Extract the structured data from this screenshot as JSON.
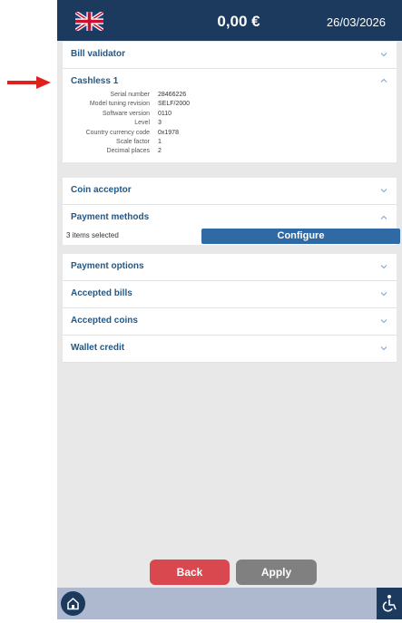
{
  "header": {
    "amount": "0,00 €",
    "date": "26/03/2026"
  },
  "sections": {
    "bill_validator": "Bill validator",
    "cashless": "Cashless 1",
    "coin_acceptor": "Coin acceptor",
    "payment_methods": "Payment methods",
    "payment_options": "Payment options",
    "accepted_bills": "Accepted bills",
    "accepted_coins": "Accepted coins",
    "wallet_credit": "Wallet credit"
  },
  "cashless_details": [
    {
      "label": "Serial number",
      "value": "28466226"
    },
    {
      "label": "Model tuning revision",
      "value": "SELF/2000"
    },
    {
      "label": "Software version",
      "value": "0110"
    },
    {
      "label": "Level",
      "value": "3"
    },
    {
      "label": "Country currency code",
      "value": "0x1978"
    },
    {
      "label": "Scale factor",
      "value": "1"
    },
    {
      "label": "Decimal places",
      "value": "2"
    }
  ],
  "payment_methods": {
    "selected_text": "3 items selected",
    "configure_label": "Configure"
  },
  "footer": {
    "back_label": "Back",
    "apply_label": "Apply"
  },
  "colors": {
    "header": "#1c3a5e",
    "accent": "#1b5a91",
    "back": "#d9474f",
    "apply": "#808080",
    "configure": "#2f6aa4",
    "arrow": "#e0201c"
  }
}
